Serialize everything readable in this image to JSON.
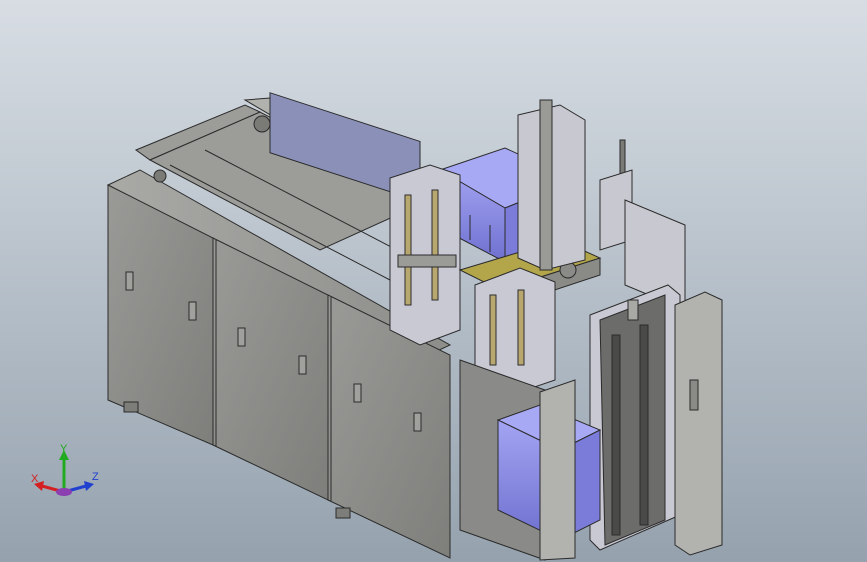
{
  "viewport": {
    "background_top": "#d7dde3",
    "background_bottom": "#95a2ae"
  },
  "model": {
    "frame_color": "#8a8a86",
    "panel_color": "#8f8f8c",
    "bin_color": "#8f90e8",
    "dark_edge": "#2b2b2b"
  },
  "triad": {
    "x_label": "X",
    "y_label": "Y",
    "z_label": "Z",
    "x_color": "#d42020",
    "y_color": "#22aa22",
    "z_color": "#2040d0"
  }
}
